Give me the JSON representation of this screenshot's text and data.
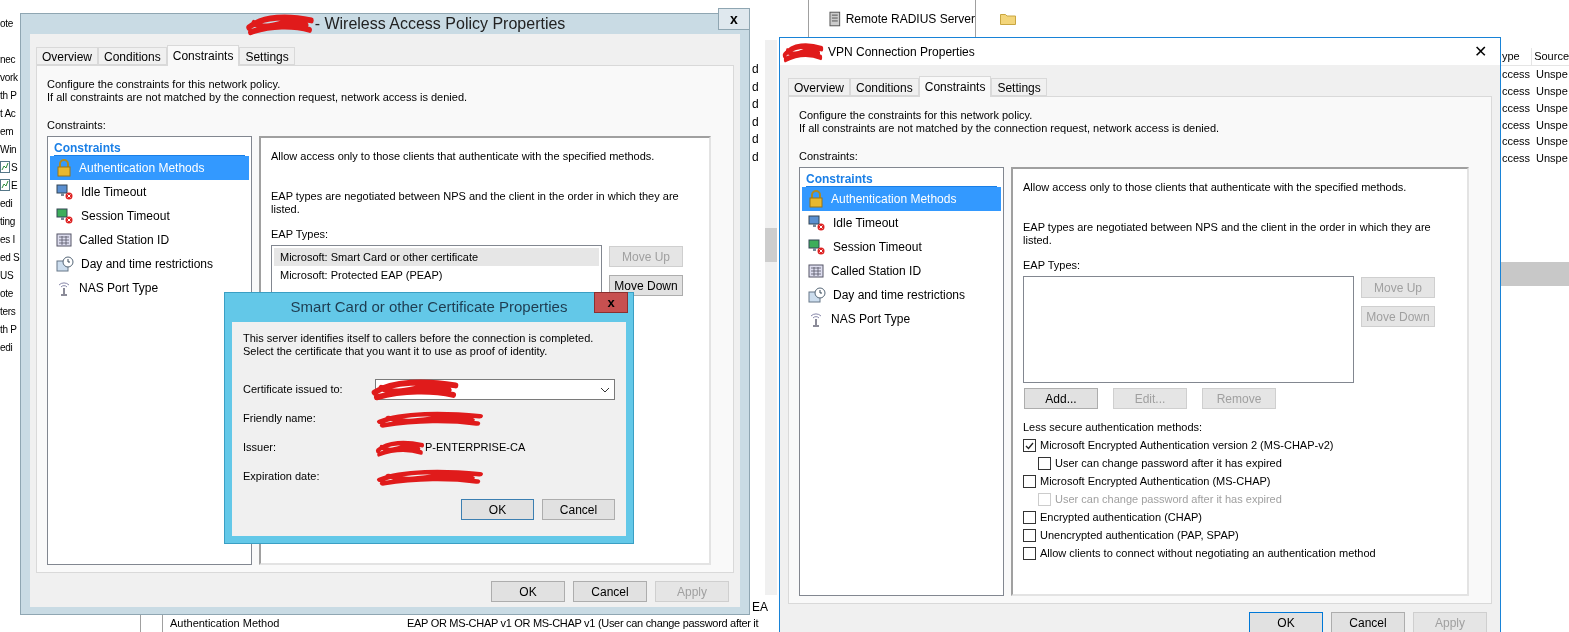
{
  "console": {
    "tree_fragments": [
      {
        "label": "ote",
        "kind": "text"
      },
      {
        "label": "nec",
        "kind": "text"
      },
      {
        "label": "vork",
        "kind": "text"
      },
      {
        "label": "th P",
        "kind": "text"
      },
      {
        "label": "t Ac",
        "kind": "text"
      },
      {
        "label": "em",
        "kind": "text"
      },
      {
        "label": "Win",
        "kind": "text"
      },
      {
        "label": "S",
        "kind": "chart"
      },
      {
        "label": "E",
        "kind": "chart"
      },
      {
        "label": "edi",
        "kind": "text"
      },
      {
        "label": "ting",
        "kind": "text"
      },
      {
        "label": "es I",
        "kind": "text"
      },
      {
        "label": "ed S",
        "kind": "text"
      },
      {
        "label": "US",
        "kind": "text"
      },
      {
        "label": "ote",
        "kind": "text"
      },
      {
        "label": "ters",
        "kind": "text"
      },
      {
        "label": "th P",
        "kind": "text"
      },
      {
        "label": "edi",
        "kind": "text"
      }
    ],
    "column_fragments": [
      "d",
      "d",
      "d",
      "d",
      "d",
      "d"
    ],
    "footer_fragment": "EA",
    "top_node": "Remote RADIUS Server",
    "list_columns": [
      "ype",
      "Source"
    ],
    "list_rows": [
      {
        "column_1": "ccess",
        "column_2": "Unspe"
      },
      {
        "column_1": "ccess",
        "column_2": "Unspe"
      },
      {
        "column_1": "ccess",
        "column_2": "Unspe"
      },
      {
        "column_1": "ccess",
        "column_2": "Unspe"
      },
      {
        "column_1": "ccess",
        "column_2": "Unspe"
      },
      {
        "column_1": "ccess",
        "column_2": "Unspe"
      }
    ],
    "footer_row": {
      "label": "Authentication Method",
      "value": "EAP OR MS-CHAP v1 OR MS-CHAP v1 (User can change password after it"
    }
  },
  "dialogs": [
    {
      "kind": "classic",
      "title": "- Wireless Access Policy Properties",
      "title_redacted": true,
      "close": "x",
      "tabs": [
        {
          "label": "Overview",
          "selected": false
        },
        {
          "label": "Conditions",
          "selected": false
        },
        {
          "label": "Constraints",
          "selected": true
        },
        {
          "label": "Settings",
          "selected": false
        }
      ],
      "description": [
        "Configure the constraints for this network policy.",
        "If all constraints are not matched by the connection request, network access is denied."
      ],
      "constraints_label": "Constraints:",
      "tree_header": "Constraints",
      "tree_items": [
        {
          "label": "Authentication Methods",
          "kind": "lock",
          "selected": true
        },
        {
          "label": "Idle Timeout",
          "kind": "idle",
          "selected": false
        },
        {
          "label": "Session Timeout",
          "kind": "session",
          "selected": false
        },
        {
          "label": "Called Station ID",
          "kind": "station",
          "selected": false
        },
        {
          "label": "Day and time restrictions",
          "kind": "clock",
          "selected": false
        },
        {
          "label": "NAS Port Type",
          "kind": "antenna",
          "selected": false
        }
      ],
      "pane": {
        "intro": "Allow access only to those clients that authenticate with the specified methods.",
        "eap_note": "EAP types are negotiated between NPS and the client in the order in which they are listed.",
        "eap_label": "EAP Types:",
        "eap_types": [
          {
            "label": "Microsoft: Smart Card or other certificate",
            "selected": true
          },
          {
            "label": "Microsoft: Protected EAP (PEAP)",
            "selected": false
          }
        ],
        "side_buttons": [
          {
            "label": "Move Up",
            "disabled": true
          },
          {
            "label": "Move Down",
            "disabled": false
          }
        ]
      },
      "buttons": [
        {
          "label": "OK",
          "disabled": false,
          "default": false
        },
        {
          "label": "Cancel",
          "disabled": false,
          "default": false
        },
        {
          "label": "Apply",
          "disabled": true,
          "default": false
        }
      ]
    },
    {
      "kind": "modern",
      "title": "VPN Connection Properties",
      "title_redacted": true,
      "close": "✕",
      "tabs": [
        {
          "label": "Overview",
          "selected": false
        },
        {
          "label": "Conditions",
          "selected": false
        },
        {
          "label": "Constraints",
          "selected": true
        },
        {
          "label": "Settings",
          "selected": false
        }
      ],
      "description": [
        "Configure the constraints for this network policy.",
        "If all constraints are not matched by the connection request, network access is denied."
      ],
      "constraints_label": "Constraints:",
      "tree_header": "Constraints",
      "tree_items": [
        {
          "label": "Authentication Methods",
          "kind": "lock",
          "selected": true
        },
        {
          "label": "Idle Timeout",
          "kind": "idle",
          "selected": false
        },
        {
          "label": "Session Timeout",
          "kind": "session",
          "selected": false
        },
        {
          "label": "Called Station ID",
          "kind": "station",
          "selected": false
        },
        {
          "label": "Day and time restrictions",
          "kind": "clock",
          "selected": false
        },
        {
          "label": "NAS Port Type",
          "kind": "antenna",
          "selected": false
        }
      ],
      "pane": {
        "intro": "Allow access only to those clients that authenticate with the specified methods.",
        "eap_note": "EAP types are negotiated between NPS and the client in the order in which they are listed.",
        "eap_label": "EAP Types:",
        "side_buttons": [
          {
            "label": "Move Up",
            "disabled": true
          },
          {
            "label": "Move Down",
            "disabled": true
          }
        ],
        "action_buttons": [
          {
            "label": "Add...",
            "disabled": false
          },
          {
            "label": "Edit...",
            "disabled": true
          },
          {
            "label": "Remove",
            "disabled": true
          }
        ],
        "less_secure_label": "Less secure authentication methods:",
        "methods": [
          {
            "label": "Microsoft Encrypted Authentication version 2 (MS-CHAP-v2)",
            "checked": true,
            "disabled": false,
            "children": [
              {
                "label": "User can change password after it has expired",
                "checked": false,
                "disabled": false
              }
            ]
          },
          {
            "label": "Microsoft Encrypted Authentication (MS-CHAP)",
            "checked": false,
            "disabled": false,
            "children": [
              {
                "label": "User can change password after it has expired",
                "checked": false,
                "disabled": true
              }
            ]
          },
          {
            "label": "Encrypted authentication (CHAP)",
            "checked": false,
            "disabled": false
          },
          {
            "label": "Unencrypted authentication (PAP, SPAP)",
            "checked": false,
            "disabled": false
          },
          {
            "label": "Allow clients to connect without negotiating an authentication method",
            "checked": false,
            "disabled": false
          }
        ]
      },
      "buttons": [
        {
          "label": "OK",
          "disabled": false,
          "default": true
        },
        {
          "label": "Cancel",
          "disabled": false,
          "default": false
        },
        {
          "label": "Apply",
          "disabled": true,
          "default": false
        }
      ]
    }
  ],
  "certificate_dialog": {
    "title": "Smart Card or other Certificate Properties",
    "close": "x",
    "text": "This server identifies itself to callers before the connection is completed. Select the certificate that you want it to use as proof of identity.",
    "fields": [
      {
        "label": "Certificate issued to:",
        "kind": "dropdown",
        "redacted": true
      },
      {
        "label": "Friendly name:",
        "kind": "text",
        "redacted": true
      },
      {
        "label": "Issuer:",
        "kind": "text",
        "redacted": true,
        "value": "P-ENTERPRISE-CA"
      },
      {
        "label": "Expiration date:",
        "kind": "text",
        "redacted": true
      }
    ],
    "buttons": [
      {
        "label": "OK",
        "default": true
      },
      {
        "label": "Cancel",
        "default": false
      }
    ]
  }
}
